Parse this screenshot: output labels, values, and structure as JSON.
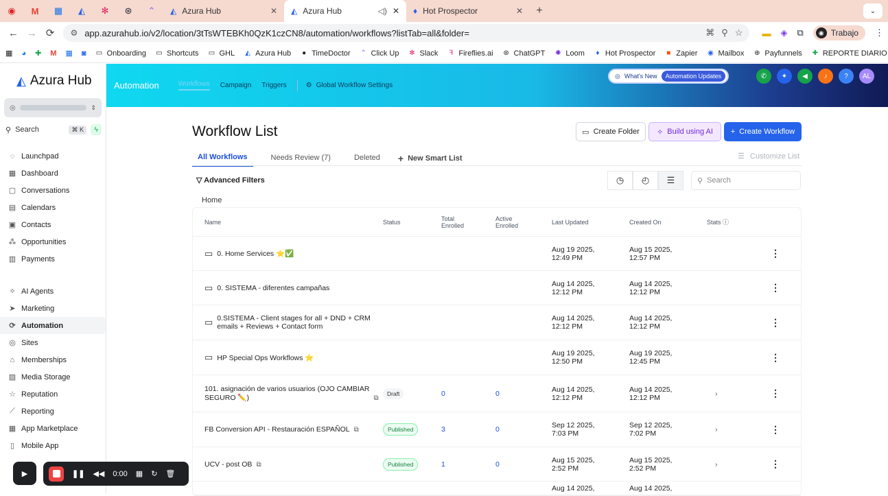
{
  "browser": {
    "tabs": [
      {
        "title": "Azura Hub",
        "active": false
      },
      {
        "title": "Azura Hub",
        "active": true
      },
      {
        "title": "Hot Prospector",
        "active": false
      }
    ],
    "url": "app.azurahub.io/v2/location/3tTsWTEBKh0QzK1czCN8/automation/workflows?listTab=all&folder=",
    "profile": "Trabajo",
    "bookmarks": [
      "Onboarding",
      "Shortcuts",
      "GHL",
      "Azura Hub",
      "TimeDoctor",
      "Click Up",
      "Slack",
      "Fireflies.ai",
      "ChatGPT",
      "Loom",
      "Hot Prospector",
      "Zapier",
      "Mailbox",
      "Payfunnels",
      "REPORTE DIARIO"
    ]
  },
  "sidebar": {
    "brand": "Azura Hub",
    "search_label": "Search",
    "search_shortcut": "⌘ K",
    "items_top": [
      {
        "label": "Launchpad",
        "icon": "rocket-icon",
        "glyph": "◌"
      },
      {
        "label": "Dashboard",
        "icon": "grid-icon",
        "glyph": "▦"
      },
      {
        "label": "Conversations",
        "icon": "chat-icon",
        "glyph": "▢"
      },
      {
        "label": "Calendars",
        "icon": "calendar-icon",
        "glyph": "▤"
      },
      {
        "label": "Contacts",
        "icon": "contacts-icon",
        "glyph": "▣"
      },
      {
        "label": "Opportunities",
        "icon": "funnel-icon",
        "glyph": "⁂"
      },
      {
        "label": "Payments",
        "icon": "receipt-icon",
        "glyph": "▥"
      }
    ],
    "items_bottom": [
      {
        "label": "AI Agents",
        "icon": "sparkle-icon",
        "glyph": "✧",
        "active": false
      },
      {
        "label": "Marketing",
        "icon": "send-icon",
        "glyph": "➤",
        "active": false
      },
      {
        "label": "Automation",
        "icon": "automation-icon",
        "glyph": "⟳",
        "active": true
      },
      {
        "label": "Sites",
        "icon": "globe-icon",
        "glyph": "◎",
        "active": false
      },
      {
        "label": "Memberships",
        "icon": "graduation-icon",
        "glyph": "⌂",
        "active": false
      },
      {
        "label": "Media Storage",
        "icon": "image-icon",
        "glyph": "▨",
        "active": false
      },
      {
        "label": "Reputation",
        "icon": "star-icon",
        "glyph": "☆",
        "active": false
      },
      {
        "label": "Reporting",
        "icon": "chart-icon",
        "glyph": "⟋",
        "active": false
      },
      {
        "label": "App Marketplace",
        "icon": "apps-icon",
        "glyph": "▦",
        "active": false
      },
      {
        "label": "Mobile App",
        "icon": "phone-icon",
        "glyph": "▯",
        "active": false
      }
    ]
  },
  "topbar": {
    "title": "Automation",
    "links": [
      "Workflows",
      "Campaign",
      "Triggers"
    ],
    "global_settings": "Global Workflow Settings",
    "whats_new": "What's New",
    "automation_updates": "Automation Updates",
    "avatar": "AL"
  },
  "main": {
    "title": "Workflow List",
    "btn_folder": "Create Folder",
    "btn_ai": "Build using AI",
    "btn_create": "Create Workflow",
    "tabs": [
      "All Workflows",
      "Needs Review (7)",
      "Deleted"
    ],
    "new_smart_list": "New Smart List",
    "customize": "Customize List",
    "advanced_filters": "Advanced Filters",
    "search_placeholder": "Search",
    "breadcrumb": "Home",
    "columns": {
      "name": "Name",
      "status": "Status",
      "total_1": "Total",
      "total_2": "Enrolled",
      "active_1": "Active",
      "active_2": "Enrolled",
      "updated": "Last Updated",
      "created": "Created On",
      "stats": "Stats"
    },
    "rows": [
      {
        "type": "folder",
        "name_1": "0. Home Services ⭐✅",
        "name_2": "",
        "status": "",
        "total": "",
        "active": "",
        "upd_1": "Aug 19 2025,",
        "upd_2": "12:49 PM",
        "cr_1": "Aug 15 2025,",
        "cr_2": "12:57 PM",
        "h": 50
      },
      {
        "type": "folder",
        "name_1": "0. SISTEMA - diferentes campañas",
        "name_2": "",
        "status": "",
        "total": "",
        "active": "",
        "upd_1": "Aug 14 2025,",
        "upd_2": "12:12 PM",
        "cr_1": "Aug 14 2025,",
        "cr_2": "12:12 PM",
        "h": 50
      },
      {
        "type": "folder",
        "name_1": "0.SISTEMA - Client stages for all + DND + CRM",
        "name_2": "emails + Reviews + Contact form",
        "status": "",
        "total": "",
        "active": "",
        "upd_1": "Aug 14 2025,",
        "upd_2": "12:12 PM",
        "cr_1": "Aug 14 2025,",
        "cr_2": "12:12 PM",
        "h": 51
      },
      {
        "type": "folder",
        "name_1": "HP Special Ops Workflows ⭐",
        "name_2": "",
        "status": "",
        "total": "",
        "active": "",
        "upd_1": "Aug 19 2025,",
        "upd_2": "12:50 PM",
        "cr_1": "Aug 19 2025,",
        "cr_2": "12:45 PM",
        "h": 51
      },
      {
        "type": "workflow",
        "name_1": "101. asignación de varios usuarios (OJO CAMBIAR",
        "name_2": "SEGURO ✏️)",
        "status": "Draft",
        "total": "0",
        "active": "0",
        "upd_1": "Aug 14 2025,",
        "upd_2": "12:12 PM",
        "cr_1": "Aug 14 2025,",
        "cr_2": "12:12 PM",
        "h": 54
      },
      {
        "type": "workflow",
        "name_1": "FB Conversion API - Restauración ESPAÑOL",
        "name_2": "",
        "status": "Published",
        "total": "3",
        "active": "0",
        "upd_1": "Sep 12 2025,",
        "upd_2": "7:03 PM",
        "cr_1": "Sep 12 2025,",
        "cr_2": "7:02 PM",
        "h": 51
      },
      {
        "type": "workflow",
        "name_1": "UCV - post OB",
        "name_2": "",
        "status": "Published",
        "total": "1",
        "active": "0",
        "upd_1": "Aug 15 2025,",
        "upd_2": "2:52 PM",
        "cr_1": "Aug 15 2025,",
        "cr_2": "2:52 PM",
        "h": 50
      },
      {
        "type": "workflow",
        "name_1": "",
        "name_2": "",
        "status": "",
        "total": "",
        "active": "",
        "upd_1": "Aug 14 2025,",
        "upd_2": "",
        "cr_1": "Aug 14 2025,",
        "cr_2": "",
        "h": 20
      }
    ]
  },
  "recorder": {
    "time": "0:00"
  }
}
